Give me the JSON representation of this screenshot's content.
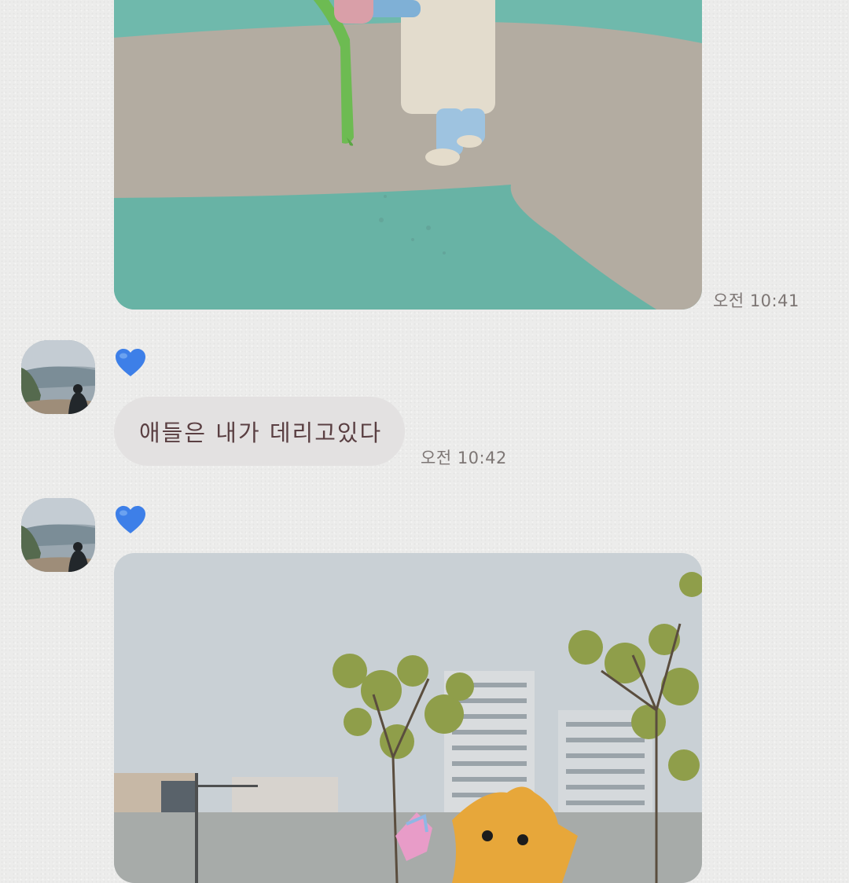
{
  "messages": [
    {
      "type": "image",
      "description_icon": "photo-playground",
      "timestamp": "오전 10:41"
    },
    {
      "type": "text",
      "sender_badge": "blue-heart-icon",
      "text": "애들은 내가 데리고있다",
      "timestamp": "오전 10:42"
    },
    {
      "type": "image",
      "sender_badge": "blue-heart-icon",
      "description_icon": "photo-street"
    }
  ],
  "colors": {
    "background": "#ececeb",
    "bubble": "#e3e1e1",
    "bubble_text": "#5a3f42",
    "timestamp": "#7d7674",
    "heart": "#3d7fe8"
  }
}
